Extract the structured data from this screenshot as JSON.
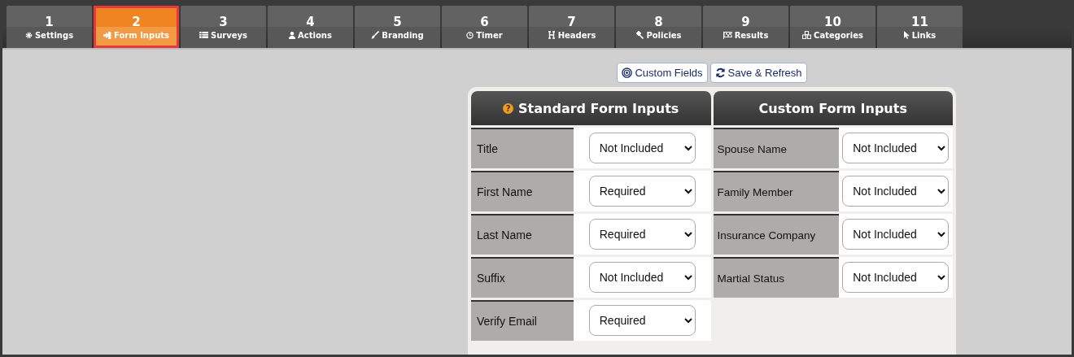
{
  "tabs": [
    {
      "number": "1",
      "label": "Settings",
      "selected": false
    },
    {
      "number": "2",
      "label": "Form Inputs",
      "selected": true
    },
    {
      "number": "3",
      "label": "Surveys",
      "selected": false
    },
    {
      "number": "4",
      "label": "Actions",
      "selected": false
    },
    {
      "number": "5",
      "label": "Branding",
      "selected": false
    },
    {
      "number": "6",
      "label": "Timer",
      "selected": false
    },
    {
      "number": "7",
      "label": "Headers",
      "selected": false
    },
    {
      "number": "8",
      "label": "Policies",
      "selected": false
    },
    {
      "number": "9",
      "label": "Results",
      "selected": false
    },
    {
      "number": "10",
      "label": "Categories",
      "selected": false
    },
    {
      "number": "11",
      "label": "Links",
      "selected": false
    }
  ],
  "toolbar": [
    {
      "label": "Custom Fields"
    },
    {
      "label": "Save & Refresh"
    }
  ],
  "standard": {
    "title": "Standard Form Inputs",
    "help": "?",
    "rows": [
      {
        "label": "Title",
        "value": "Not Included"
      },
      {
        "label": "First Name",
        "value": "Required"
      },
      {
        "label": "Last Name",
        "value": "Required"
      },
      {
        "label": "Suffix",
        "value": "Not Included"
      },
      {
        "label": "Verify Email",
        "value": "Required"
      }
    ]
  },
  "custom": {
    "title": "Custom Form Inputs",
    "rows": [
      {
        "label": "Spouse Name",
        "value": "Not Included"
      },
      {
        "label": "Family Member",
        "value": "Not Included"
      },
      {
        "label": "Insurance Company",
        "value": "Not Included"
      },
      {
        "label": "Martial Status",
        "value": "Not Included"
      }
    ]
  }
}
